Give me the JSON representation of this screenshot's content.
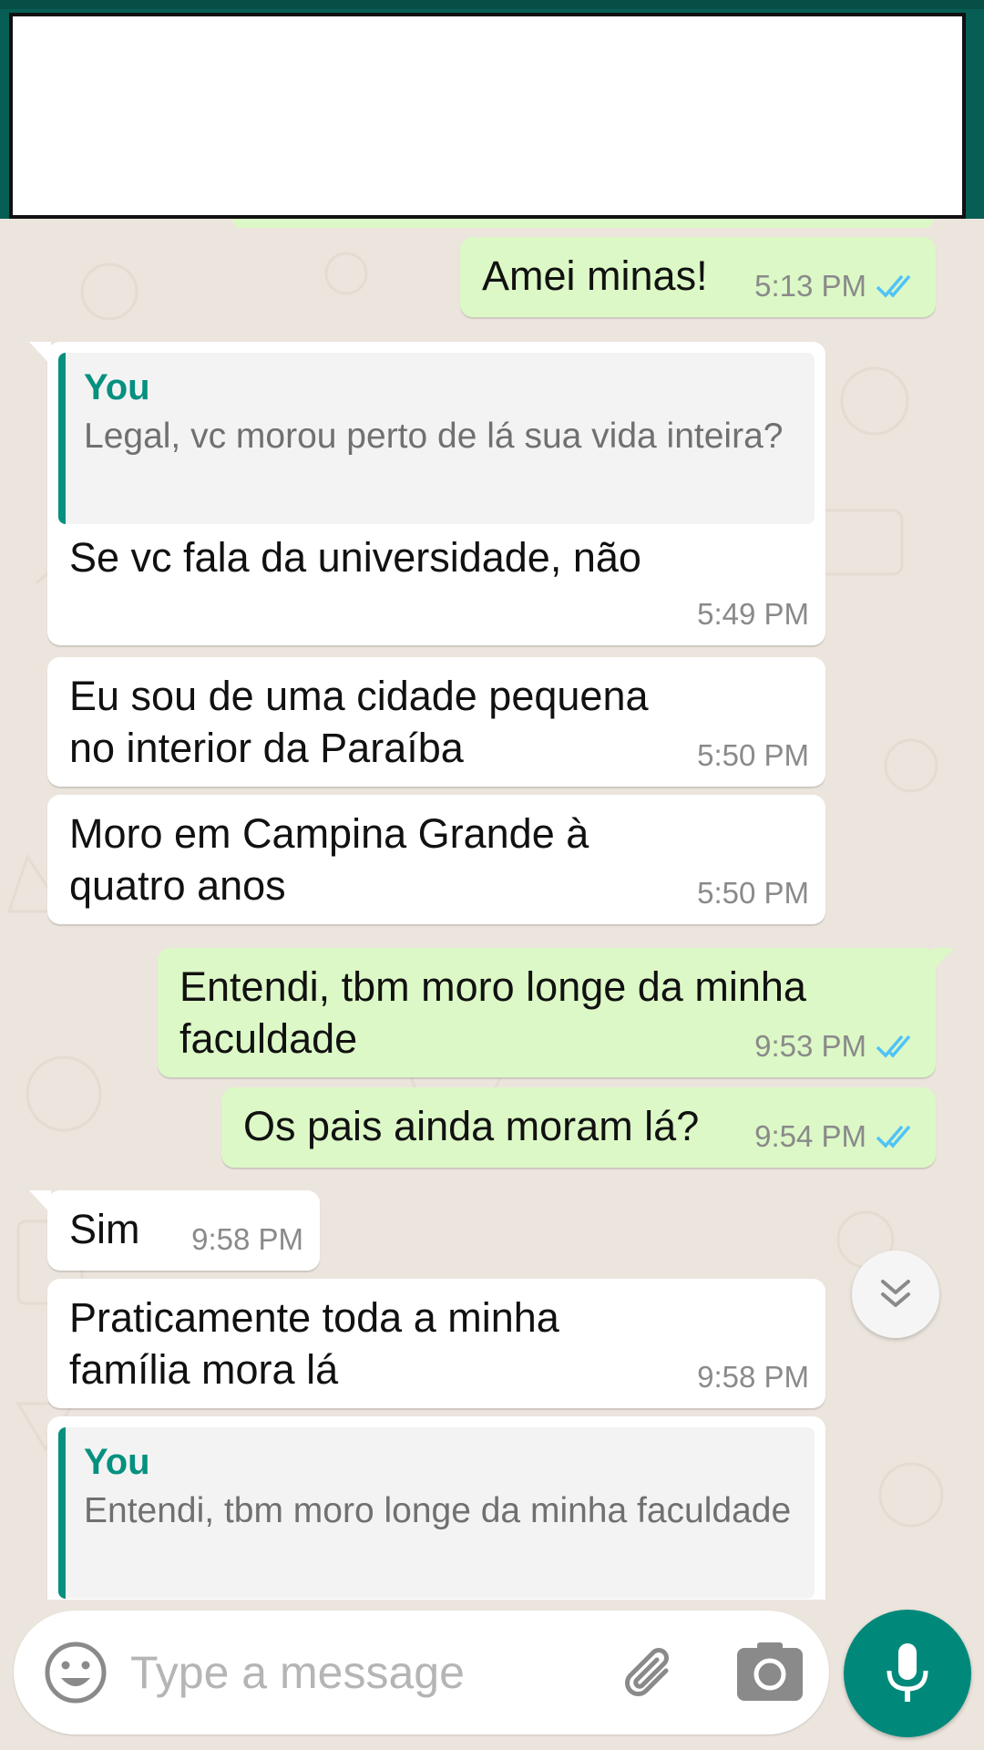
{
  "colors": {
    "header": "#075e54",
    "incoming_bubble": "#ffffff",
    "outgoing_bubble": "#dcf8c6",
    "quote_accent": "#06907f",
    "read_ticks": "#4fc3f7",
    "mic_button": "#00897b"
  },
  "messages": [
    {
      "text": "Amei minas!",
      "time": "5:13 PM",
      "status": "read"
    },
    {
      "quote_author": "You",
      "quote_text": "Legal, vc morou perto de lá sua vida inteira?",
      "text": "Se vc fala da universidade, não",
      "time": "5:49 PM"
    },
    {
      "text": "Eu sou de uma cidade pequena no interior da Paraíba",
      "time": "5:50 PM"
    },
    {
      "text": "Moro em Campina Grande à quatro anos",
      "time": "5:50 PM"
    },
    {
      "text": "Entendi, tbm moro longe da minha faculdade",
      "time": "9:53 PM",
      "status": "read"
    },
    {
      "text": "Os pais ainda moram lá?",
      "time": "9:54 PM",
      "status": "read"
    },
    {
      "text": "Sim",
      "time": "9:58 PM"
    },
    {
      "text": "Praticamente toda a minha família mora lá",
      "time": "9:58 PM"
    },
    {
      "quote_author": "You",
      "quote_text": "Entendi, tbm moro longe da minha faculdade"
    }
  ],
  "composer": {
    "placeholder": "Type a message"
  },
  "icons": {
    "emoji": "emoji-icon",
    "attach": "paperclip-icon",
    "camera": "camera-icon",
    "mic": "microphone-icon",
    "scroll": "chevron-double-down-icon",
    "ticks": "double-check-icon"
  }
}
